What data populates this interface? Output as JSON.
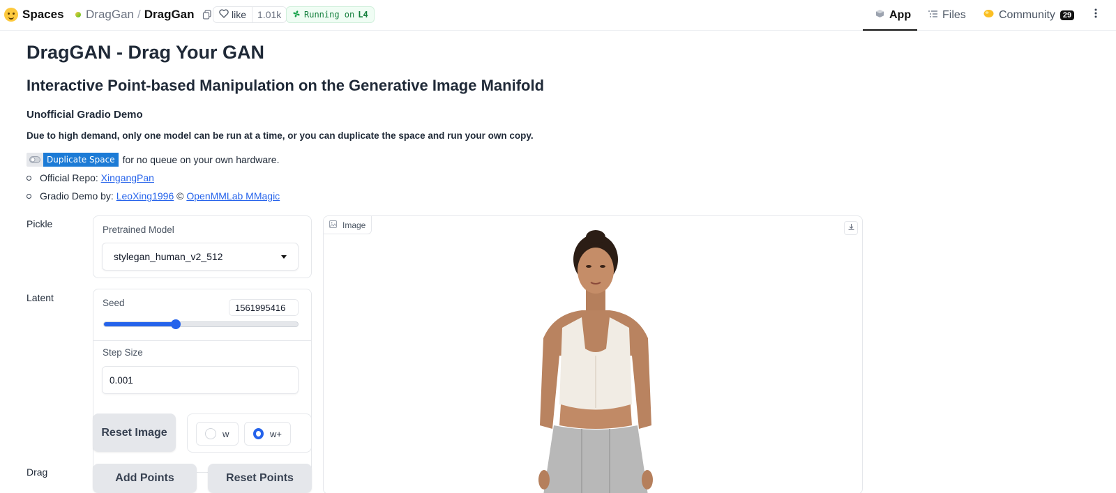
{
  "topbar": {
    "brand": "Spaces",
    "owner": "DragGan",
    "separator": "/",
    "repo": "DragGan",
    "like_label": "like",
    "like_count": "1.01k",
    "status_prefix": "Running on",
    "status_hardware": "L4",
    "tabs": [
      {
        "label": "App",
        "icon": "cube-icon",
        "active": true
      },
      {
        "label": "Files",
        "icon": "files-icon",
        "active": false
      },
      {
        "label": "Community",
        "icon": "community-icon",
        "active": false,
        "badge": "29"
      }
    ]
  },
  "header": {
    "title": "DragGAN - Drag Your GAN",
    "subtitle": "Interactive Point-based Manipulation on the Generative Image Manifold",
    "demo_label": "Unofficial Gradio Demo",
    "notice": "Due to high demand, only one model can be run at a time, or you can duplicate the space and run your own copy.",
    "duplicate_badge": "Duplicate Space",
    "duplicate_suffix": "for no queue on your own hardware.",
    "repo_prefix": "Official Repo:",
    "repo_link": "XingangPan",
    "demo_by_prefix": "Gradio Demo by:",
    "demo_by_link": "LeoXing1996",
    "copyright": "©",
    "org_link": "OpenMMLab MMagic"
  },
  "controls": {
    "pickle": {
      "section_label": "Pickle",
      "field_label": "Pretrained Model",
      "selected": "stylegan_human_v2_512"
    },
    "latent": {
      "section_label": "Latent",
      "seed_label": "Seed",
      "seed_value": "1561995416",
      "seed_slider_fraction": 0.37,
      "step_label": "Step Size",
      "step_value": "0.001",
      "reset_image": "Reset Image",
      "space_options": [
        {
          "label": "w",
          "checked": false
        },
        {
          "label": "w+",
          "checked": true
        }
      ]
    },
    "drag": {
      "section_label": "Drag",
      "add_points": "Add Points",
      "reset_points": "Reset Points"
    }
  },
  "image_panel": {
    "label": "Image"
  },
  "colors": {
    "accent": "#2563eb",
    "running_green": "#15803d",
    "duplicate_blue": "#1c7bd6"
  }
}
